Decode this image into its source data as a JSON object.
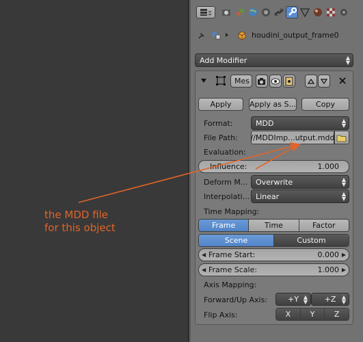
{
  "header": {
    "object_name": "houdini_output_frame0"
  },
  "modifier": {
    "add_label": "Add Modifier",
    "name_field": "Mes",
    "apply_label": "Apply",
    "apply_as_label": "Apply as S...",
    "copy_label": "Copy",
    "format_label": "Format:",
    "format_value": "MDD",
    "filepath_label": "File Path:",
    "filepath_value": "//MDDImp...utput.mdd",
    "evaluation_label": "Evaluation:",
    "influence_label": "Influence:",
    "influence_value": "1.000",
    "deform_label": "Deform M...",
    "deform_value": "Overwrite",
    "interp_label": "Interpolati...",
    "interp_value": "Linear",
    "time_mapping_label": "Time Mapping:",
    "time_tabs": [
      "Frame",
      "Time",
      "Factor"
    ],
    "time_active": "Frame",
    "scene_label": "Scene",
    "custom_label": "Custom",
    "frame_start_label": "Frame Start:",
    "frame_start_value": "0.000",
    "frame_scale_label": "Frame Scale:",
    "frame_scale_value": "1.000",
    "axis_mapping_label": "Axis Mapping:",
    "forward_up_label": "Forward/Up Axis:",
    "forward_value": "+Y",
    "up_value": "+Z",
    "flip_label": "Flip Axis:",
    "flip_axes": [
      "X",
      "Y",
      "Z"
    ]
  },
  "annotation": {
    "line1": "the MDD file",
    "line2": "for this object",
    "color": "#e2642a"
  },
  "colors": {
    "active_blue": "#5a8ccf",
    "panel_bg": "#727272",
    "viewport_bg": "#393939"
  }
}
